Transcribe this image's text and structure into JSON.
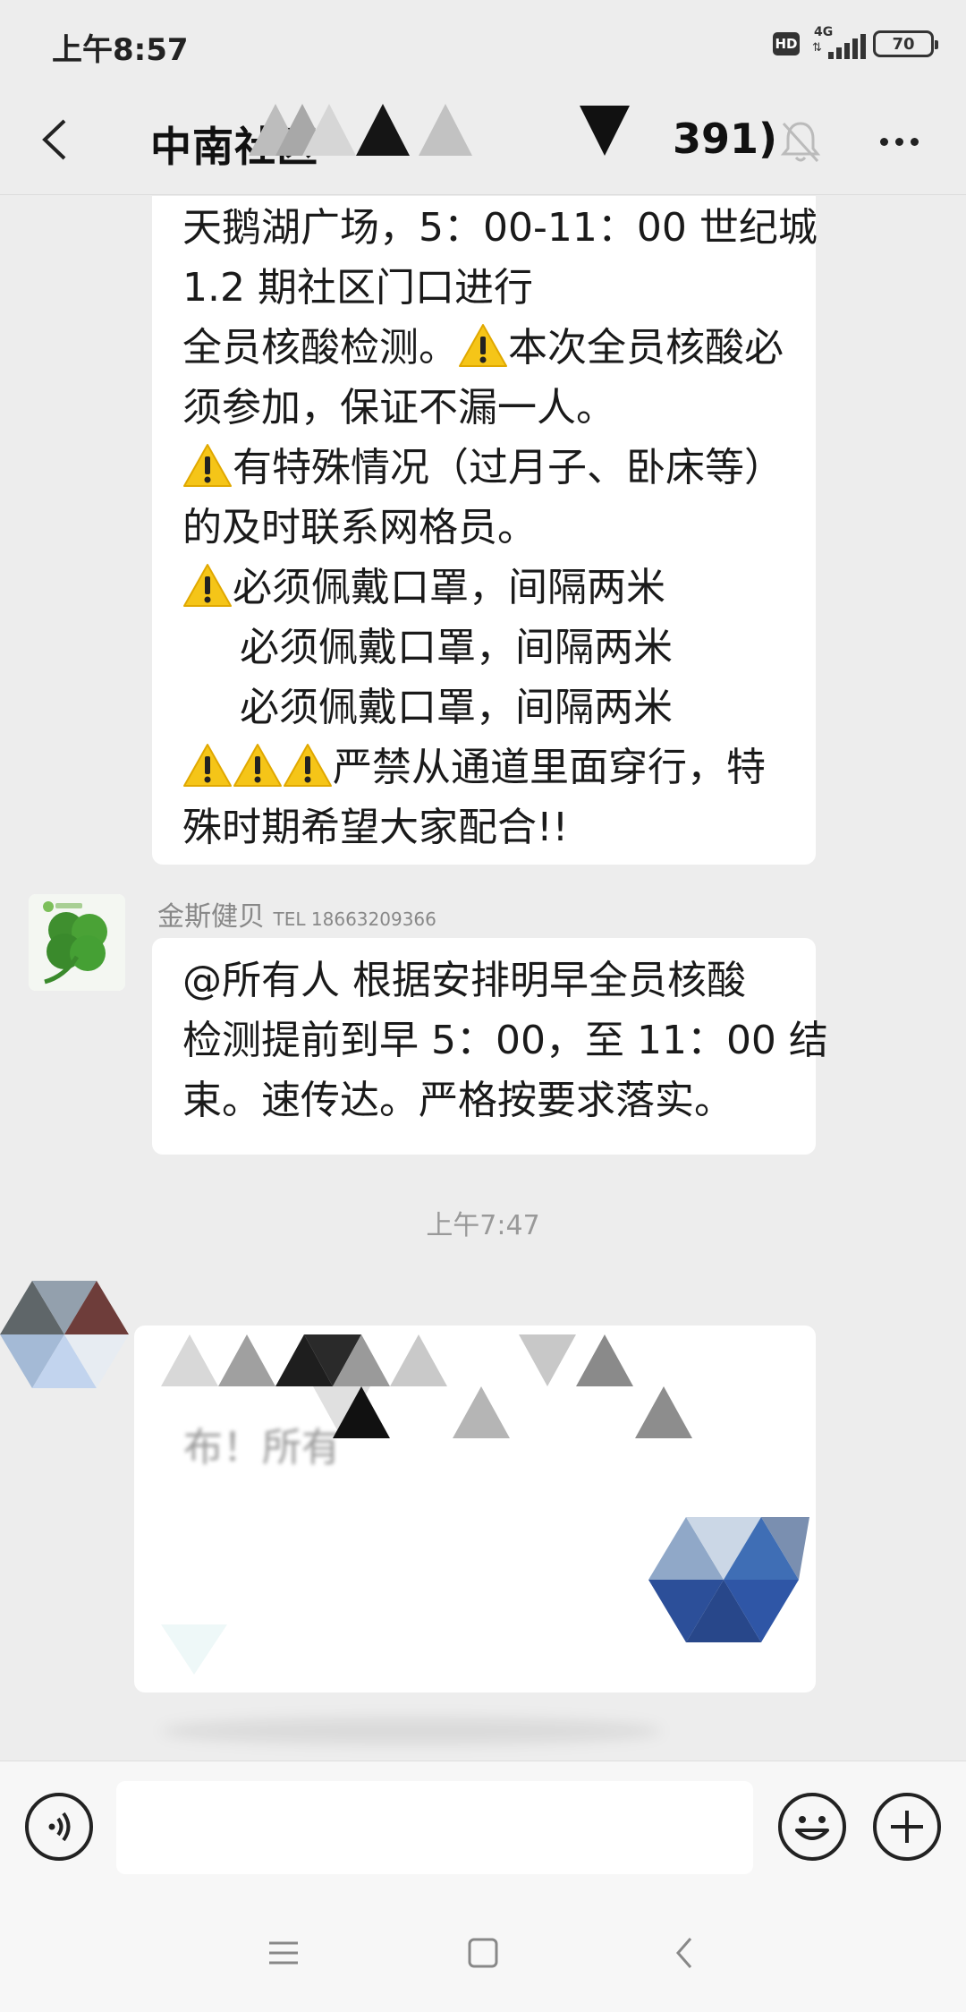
{
  "status_bar": {
    "time": "上午8:57",
    "hd_label": "HD",
    "network_label": "4G",
    "battery_level": "70"
  },
  "header": {
    "title_visible": "中南社区",
    "title_tail": "391)",
    "back_icon": "chevron-left-icon",
    "mute_icon": "bell-off-icon",
    "more_icon": "ellipsis-icon"
  },
  "messages": [
    {
      "lines": [
        "天鹅湖广场，5：00-11：00 世纪城",
        "1.2 期社区门口进行",
        "全员核酸检测。",
        "本次全员核酸必",
        "须参加，保证不漏一人。",
        "有特殊情况（过月子、卧床等）",
        "的及时联系网格员。",
        "必须佩戴口罩，间隔两米",
        "必须佩戴口罩，间隔两米",
        "必须佩戴口罩，间隔两米",
        "严禁从通道里面穿行，特",
        "殊时期希望大家配合!!"
      ]
    },
    {
      "sender": "金斯健贝",
      "sender_tel": "TEL 18663209366",
      "lines": [
        "@所有人  根据安排明早全员核酸",
        "检测提前到早 5：00，至 11：00 结",
        "束。速传达。严格按要求落实。"
      ]
    },
    {
      "timestamp": "上午7:47"
    },
    {
      "partial_text": "布！所有"
    }
  ],
  "input_bar": {
    "voice_icon": "voice-icon",
    "emoji_icon": "emoji-icon",
    "plus_icon": "plus-icon",
    "input_value": ""
  },
  "system_nav": {
    "menu_icon": "menu-icon",
    "home_icon": "home-square-icon",
    "back_icon": "back-triangle-icon"
  },
  "colors": {
    "background": "#ededed",
    "bubble": "#ffffff",
    "warning": "#f5c518",
    "muted_text": "#888888"
  }
}
